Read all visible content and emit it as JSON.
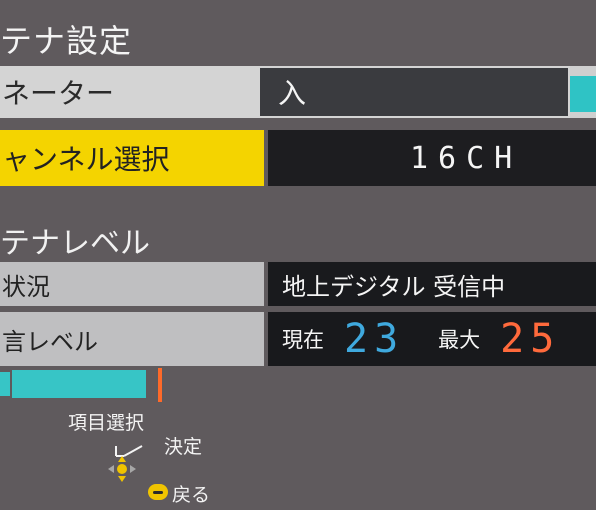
{
  "title": "テナ設定",
  "tuner": {
    "label": "ネーター",
    "value": "入"
  },
  "channel": {
    "label": "ャンネル選択",
    "value": "16CH"
  },
  "section": {
    "title": "テナレベル"
  },
  "status": {
    "label": "状況",
    "value": "地上デジタル 受信中"
  },
  "level": {
    "label": "言レベル",
    "current_label": "現在",
    "current_value": "23",
    "max_label": "最大",
    "max_value": "25"
  },
  "signal_bar": {
    "fill_fraction": 0.24,
    "max_fraction": 0.26
  },
  "help": {
    "select": "項目選択",
    "decide": "決定",
    "back": "戻る"
  },
  "colors": {
    "accent_cyan": "#37c5c6",
    "highlight_yellow": "#f4d400",
    "current_blue": "#3fa9de",
    "max_orange": "#ff6a3c",
    "background": "#5f5a5d"
  },
  "icons": [
    "dpad-icon",
    "back-button-icon"
  ]
}
